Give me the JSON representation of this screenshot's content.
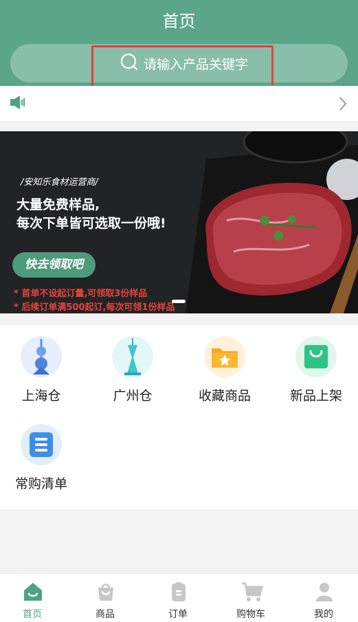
{
  "header": {
    "title": "首页"
  },
  "search": {
    "placeholder": "请输入产品关键字",
    "icon": "search-icon"
  },
  "notice": {
    "icon": "speaker-icon",
    "arrow": "chevron-right-icon"
  },
  "banner": {
    "tag": "/安知乐食材运营商/",
    "headline_1": "大量免费样品,",
    "headline_2": "每次下单皆可选取一份哦!",
    "button": "快去领取吧",
    "note_1": "* 首单不设起订量,可领取3份样品",
    "note_2": "* 后续订单满500起订,每次可领1份样品"
  },
  "categories": [
    {
      "label": "上海仓",
      "icon": "shanghai-tower-icon"
    },
    {
      "label": "广州仓",
      "icon": "canton-tower-icon"
    },
    {
      "label": "收藏商品",
      "icon": "favorites-folder-icon"
    },
    {
      "label": "新品上架",
      "icon": "shopping-bag-icon"
    },
    {
      "label": "常购清单",
      "icon": "list-icon"
    }
  ],
  "tabs": [
    {
      "label": "首页",
      "icon": "home-icon"
    },
    {
      "label": "商品",
      "icon": "bag-icon"
    },
    {
      "label": "订单",
      "icon": "order-icon"
    },
    {
      "label": "购物车",
      "icon": "cart-icon"
    },
    {
      "label": "我的",
      "icon": "user-icon"
    }
  ],
  "colors": {
    "brand": "#5ba58a",
    "active_tab": "#4ea384",
    "highlight": "#e2403e",
    "promo_text": "#e8433f"
  }
}
